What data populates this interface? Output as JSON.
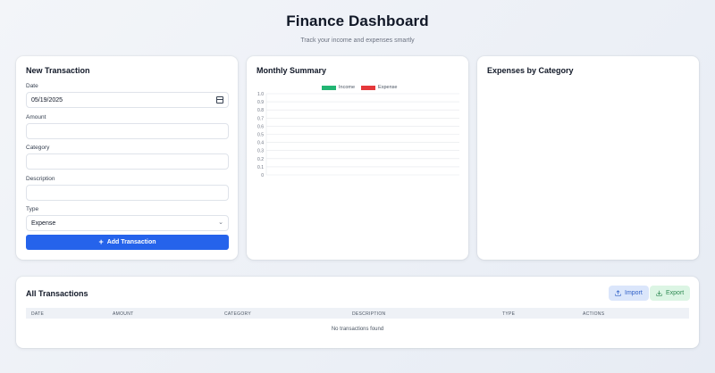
{
  "header": {
    "title": "Finance Dashboard",
    "subtitle": "Track your income and expenses smartly"
  },
  "new_transaction": {
    "title": "New Transaction",
    "date_label": "Date",
    "date_value": "05/19/2025",
    "amount_label": "Amount",
    "amount_value": "",
    "category_label": "Category",
    "category_value": "",
    "description_label": "Description",
    "description_value": "",
    "type_label": "Type",
    "type_value": "Expense",
    "add_button_label": "Add Transaction"
  },
  "monthly_summary": {
    "title": "Monthly Summary"
  },
  "expenses_by_category": {
    "title": "Expenses by Category"
  },
  "all_transactions": {
    "title": "All Transactions",
    "import_label": "Import",
    "export_label": "Export",
    "columns": [
      "DATE",
      "AMOUNT",
      "CATEGORY",
      "DESCRIPTION",
      "TYPE",
      "ACTIONS"
    ],
    "empty_text": "No transactions found"
  },
  "colors": {
    "primary": "#2563eb",
    "income": "#22b573",
    "expense": "#e5383b"
  },
  "chart_data": {
    "type": "bar",
    "categories": [],
    "series": [
      {
        "name": "Income",
        "values": [],
        "color": "#22b573"
      },
      {
        "name": "Expense",
        "values": [],
        "color": "#e5383b"
      }
    ],
    "y_ticks": [
      "1.0",
      "0.9",
      "0.8",
      "0.7",
      "0.6",
      "0.5",
      "0.4",
      "0.3",
      "0.2",
      "0.1",
      "0"
    ],
    "ylim": [
      0,
      1
    ],
    "grid": true,
    "legend": "top"
  }
}
